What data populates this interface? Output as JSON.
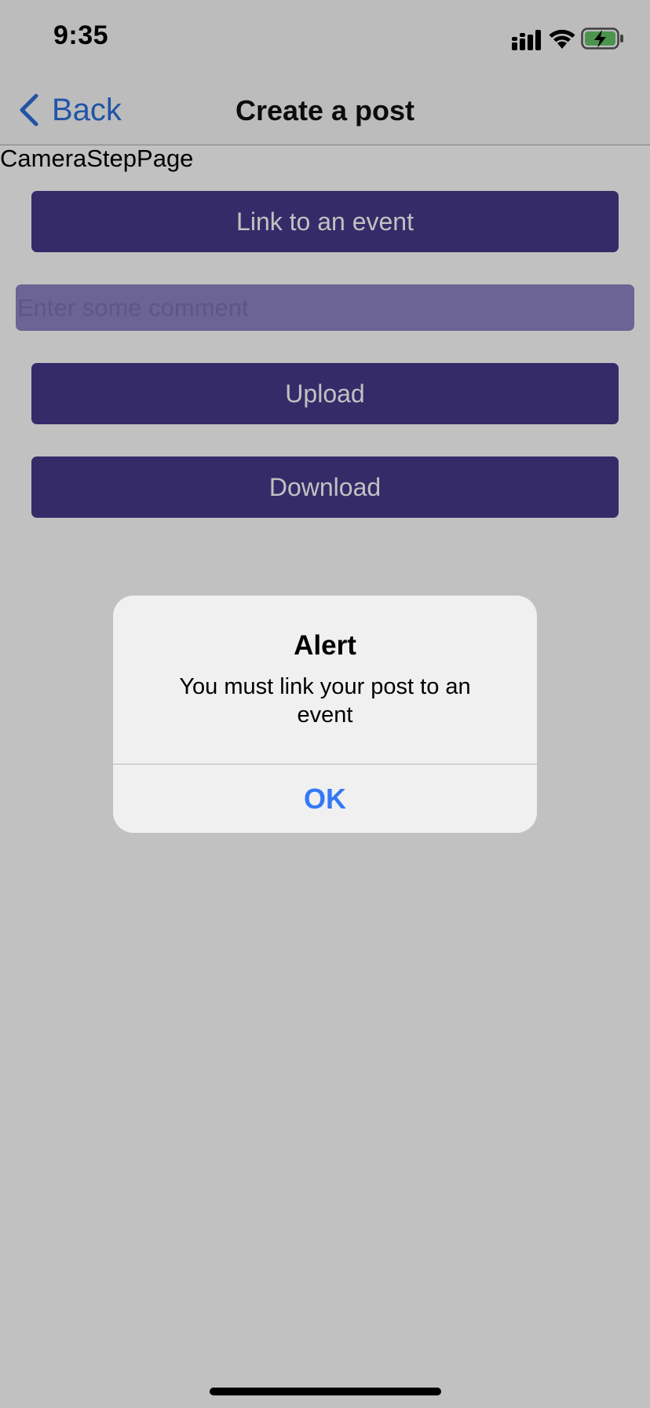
{
  "status_bar": {
    "time": "9:35",
    "icons": [
      "cellular-signal-icon",
      "wifi-icon",
      "battery-charging-icon"
    ]
  },
  "nav": {
    "back_label": "Back",
    "title": "Create a post"
  },
  "page": {
    "label": "CameraStepPage",
    "link_button": "Link to an event",
    "comment": {
      "value": "",
      "placeholder": "Enter some comment"
    },
    "upload_button": "Upload",
    "download_button": "Download"
  },
  "alert": {
    "title": "Alert",
    "message": "You must link your post to an event",
    "ok_label": "OK"
  },
  "colors": {
    "accent": "#2d6fdc",
    "button_bg": "#48398b",
    "input_bg": "#8e85c4",
    "alert_action": "#3478f6",
    "battery_fill": "#65c466"
  }
}
